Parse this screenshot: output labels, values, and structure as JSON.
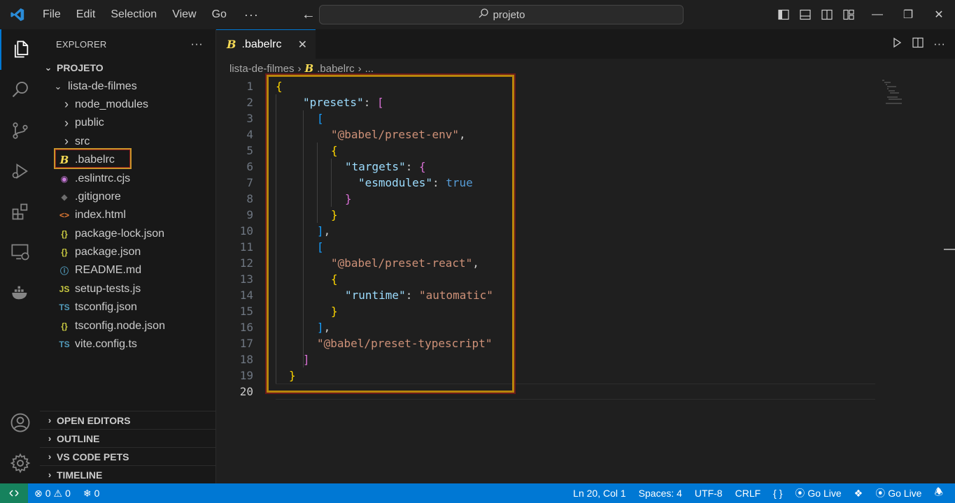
{
  "titlebar": {
    "menus": [
      "File",
      "Edit",
      "Selection",
      "View",
      "Go"
    ],
    "more": "···",
    "search_text": "projeto"
  },
  "activity": {
    "icons": [
      "files-icon",
      "search-icon",
      "source-control-icon",
      "run-debug-icon",
      "extensions-icon",
      "remote-explorer-icon",
      "docker-icon"
    ],
    "bottom_icons": [
      "account-icon",
      "manage-gear-icon"
    ]
  },
  "explorer": {
    "title": "EXPLORER",
    "more": "···",
    "root": "PROJETO",
    "folder": "lista-de-filmes",
    "items": [
      {
        "name": "node_modules",
        "type": "folder",
        "icon": ""
      },
      {
        "name": "public",
        "type": "folder",
        "icon": ""
      },
      {
        "name": "src",
        "type": "folder",
        "icon": ""
      },
      {
        "name": ".babelrc",
        "type": "file",
        "icon": "B"
      },
      {
        "name": ".eslintrc.cjs",
        "type": "file",
        "icon": "◉"
      },
      {
        "name": ".gitignore",
        "type": "file",
        "icon": "◆"
      },
      {
        "name": "index.html",
        "type": "file",
        "icon": "<>"
      },
      {
        "name": "package-lock.json",
        "type": "file",
        "icon": "{}"
      },
      {
        "name": "package.json",
        "type": "file",
        "icon": "{}"
      },
      {
        "name": "README.md",
        "type": "file",
        "icon": "ⓘ"
      },
      {
        "name": "setup-tests.js",
        "type": "file",
        "icon": "JS"
      },
      {
        "name": "tsconfig.json",
        "type": "file",
        "icon": "TS"
      },
      {
        "name": "tsconfig.node.json",
        "type": "file",
        "icon": "{}"
      },
      {
        "name": "vite.config.ts",
        "type": "file",
        "icon": "TS"
      }
    ],
    "sections": [
      "OPEN EDITORS",
      "OUTLINE",
      "VS CODE PETS",
      "TIMELINE"
    ]
  },
  "editor": {
    "tab_label": ".babelrc",
    "tab_close": "✕",
    "breadcrumb": [
      "lista-de-filmes",
      ".babelrc",
      "..."
    ],
    "line_numbers": [
      "1",
      "2",
      "3",
      "4",
      "5",
      "6",
      "7",
      "8",
      "9",
      "10",
      "11",
      "12",
      "13",
      "14",
      "15",
      "16",
      "17",
      "18",
      "19",
      "20"
    ],
    "current_line": "20",
    "lines": {
      "l1_brace": "{",
      "l2_key": "\"presets\"",
      "l2_colon": ": ",
      "l2_bracket": "[",
      "l3_bracket": "[",
      "l4_str": "\"@babel/preset-env\"",
      "l4_comma": ",",
      "l5_brace": "{",
      "l6_key": "\"targets\"",
      "l6_colon": ": ",
      "l6_brace": "{",
      "l7_key": "\"esmodules\"",
      "l7_colon": ": ",
      "l7_val": "true",
      "l8_brace": "}",
      "l9_brace": "}",
      "l10_bracket": "]",
      "l10_comma": ",",
      "l11_bracket": "[",
      "l12_str": "\"@babel/preset-react\"",
      "l12_comma": ",",
      "l13_brace": "{",
      "l14_key": "\"runtime\"",
      "l14_colon": ": ",
      "l14_val": "\"automatic\"",
      "l15_brace": "}",
      "l16_bracket": "]",
      "l16_comma": ",",
      "l17_str": "\"@babel/preset-typescript\"",
      "l18_bracket": "]",
      "l19_brace": "}"
    }
  },
  "statusbar": {
    "errors": "0",
    "warnings": "0",
    "ports": "0",
    "position": "Ln 20, Col 1",
    "spaces": "Spaces: 4",
    "encoding": "UTF-8",
    "eol": "CRLF",
    "language": "{ }",
    "golive1": "Go Live",
    "golive2": "Go Live"
  },
  "colors": {
    "accent": "#0078d4",
    "remote": "#16825d",
    "highlight_border": "#b8860b"
  }
}
